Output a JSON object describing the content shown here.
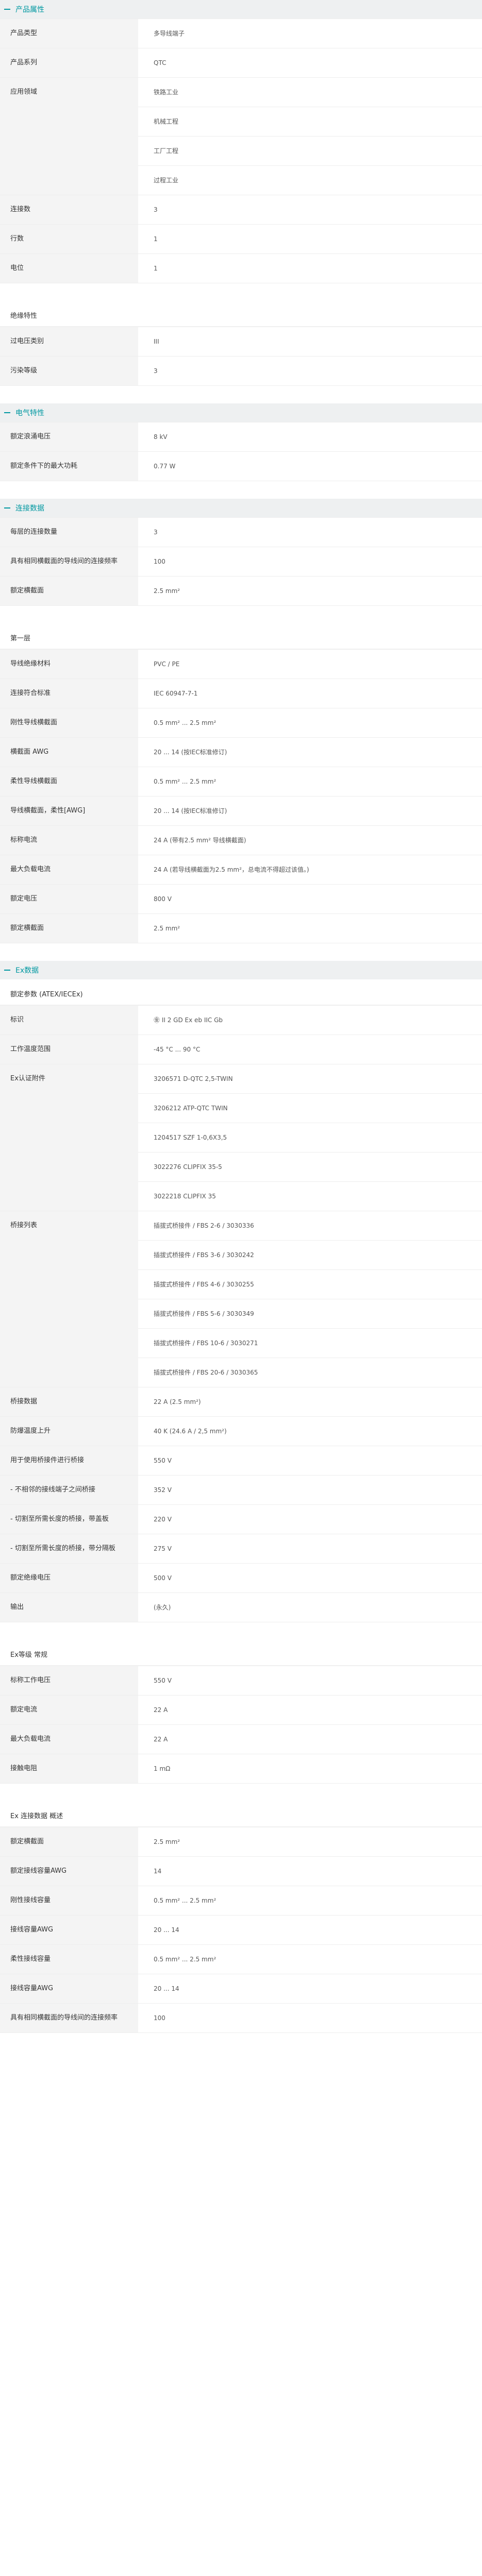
{
  "sections": [
    {
      "title": "产品属性",
      "blocks": [
        {
          "rows": [
            {
              "label": "产品类型",
              "values": [
                "多导线端子"
              ]
            },
            {
              "label": "产品系列",
              "values": [
                "QTC"
              ]
            },
            {
              "label": "应用领域",
              "values": [
                "铁路工业",
                "机械工程",
                "工厂工程",
                "过程工业"
              ]
            },
            {
              "label": "连接数",
              "values": [
                "3"
              ]
            },
            {
              "label": "行数",
              "values": [
                "1"
              ]
            },
            {
              "label": "电位",
              "values": [
                "1"
              ]
            }
          ]
        },
        {
          "subtitle": "绝缘特性",
          "rows": [
            {
              "label": "过电压类别",
              "values": [
                "III"
              ]
            },
            {
              "label": "污染等级",
              "values": [
                "3"
              ]
            }
          ]
        }
      ]
    },
    {
      "title": "电气特性",
      "blocks": [
        {
          "rows": [
            {
              "label": "额定浪涌电压",
              "values": [
                "8 kV"
              ]
            },
            {
              "label": "额定条件下的最大功耗",
              "values": [
                "0.77 W"
              ]
            }
          ]
        }
      ]
    },
    {
      "title": "连接数据",
      "blocks": [
        {
          "rows": [
            {
              "label": "每层的连接数量",
              "values": [
                "3"
              ]
            },
            {
              "label": "具有相同横截面的导线间的连接频率",
              "values": [
                "100"
              ]
            },
            {
              "label": "额定横截面",
              "values": [
                "2.5 mm²"
              ]
            }
          ]
        },
        {
          "subtitle": "第一层",
          "rows": [
            {
              "label": "导线绝缘材料",
              "values": [
                "PVC / PE"
              ]
            },
            {
              "label": "连接符合标准",
              "values": [
                "IEC 60947-7-1"
              ]
            },
            {
              "label": "刚性导线横截面",
              "values": [
                "0.5 mm² ... 2.5 mm²"
              ]
            },
            {
              "label": "横截面 AWG",
              "values": [
                "20 ... 14 (按IEC标准修订)"
              ]
            },
            {
              "label": "柔性导线横截面",
              "values": [
                "0.5 mm² ... 2.5 mm²"
              ]
            },
            {
              "label": "导线横截面，柔性[AWG]",
              "values": [
                "20 ... 14 (按IEC标准修订)"
              ]
            },
            {
              "label": "标称电流",
              "values": [
                "24 A (带有2.5 mm² 导线横截面)"
              ]
            },
            {
              "label": "最大负载电流",
              "values": [
                "24 A (若导线横截面为2.5 mm²，总电流不得超过该值。)"
              ]
            },
            {
              "label": "额定电压",
              "values": [
                "800 V"
              ]
            },
            {
              "label": "额定横截面",
              "values": [
                "2.5 mm²"
              ]
            }
          ]
        }
      ]
    },
    {
      "title": "Ex数据",
      "blocks": [
        {
          "subtitle": "额定参数 (ATEX/IECEx)",
          "rows": [
            {
              "label": "标识",
              "values": [
                "㊎ II 2 GD Ex eb IIC Gb"
              ]
            },
            {
              "label": "工作温度范围",
              "values": [
                "-45 °C ... 90 °C"
              ]
            },
            {
              "label": "Ex认证附件",
              "values": [
                "3206571 D-QTC 2,5-TWIN",
                "3206212 ATP-QTC TWIN",
                "1204517 SZF 1-0,6X3,5",
                "3022276 CLIPFIX 35-5",
                "3022218 CLIPFIX 35"
              ]
            },
            {
              "label": "桥接列表",
              "values": [
                "插拔式桥接件 / FBS 2-6 / 3030336",
                "插拔式桥接件 / FBS 3-6 / 3030242",
                "插拔式桥接件 / FBS 4-6 / 3030255",
                "插拔式桥接件 / FBS 5-6 / 3030349",
                "插拔式桥接件 / FBS 10-6 / 3030271",
                "插拔式桥接件 / FBS 20-6 / 3030365"
              ]
            },
            {
              "label": "桥接数据",
              "values": [
                "22 A (2.5 mm²)"
              ]
            },
            {
              "label": "防爆温度上升",
              "values": [
                "40 K (24.6 A / 2,5 mm²)"
              ]
            },
            {
              "label": "用于使用桥接件进行桥接",
              "values": [
                "550 V"
              ]
            },
            {
              "label": "- 不相邻的接线端子之间桥接",
              "values": [
                "352 V"
              ]
            },
            {
              "label": "- 切割至所需长度的桥接，带盖板",
              "values": [
                "220 V"
              ]
            },
            {
              "label": "- 切割至所需长度的桥接，带分隔板",
              "values": [
                "275 V"
              ]
            },
            {
              "label": "额定绝缘电压",
              "values": [
                "500 V"
              ]
            },
            {
              "label": "输出",
              "values": [
                "(永久)"
              ]
            }
          ]
        },
        {
          "subtitle": "Ex等级 常规",
          "rows": [
            {
              "label": "标称工作电压",
              "values": [
                "550 V"
              ]
            },
            {
              "label": "额定电流",
              "values": [
                "22 A"
              ]
            },
            {
              "label": "最大负载电流",
              "values": [
                "22 A"
              ]
            },
            {
              "label": "接触电阻",
              "values": [
                "1 mΩ"
              ]
            }
          ]
        },
        {
          "subtitle": "Ex 连接数据 概述",
          "rows": [
            {
              "label": "额定横截面",
              "values": [
                "2.5 mm²"
              ]
            },
            {
              "label": "额定接线容量AWG",
              "values": [
                "14"
              ]
            },
            {
              "label": "刚性接线容量",
              "values": [
                "0.5 mm² ... 2.5 mm²"
              ]
            },
            {
              "label": "接线容量AWG",
              "values": [
                "20 ... 14"
              ]
            },
            {
              "label": "柔性接线容量",
              "values": [
                "0.5 mm² ... 2.5 mm²"
              ]
            },
            {
              "label": "接线容量AWG",
              "values": [
                "20 ... 14"
              ]
            },
            {
              "label": "具有相同横截面的导线间的连接频率",
              "values": [
                "100"
              ]
            }
          ]
        }
      ]
    }
  ]
}
